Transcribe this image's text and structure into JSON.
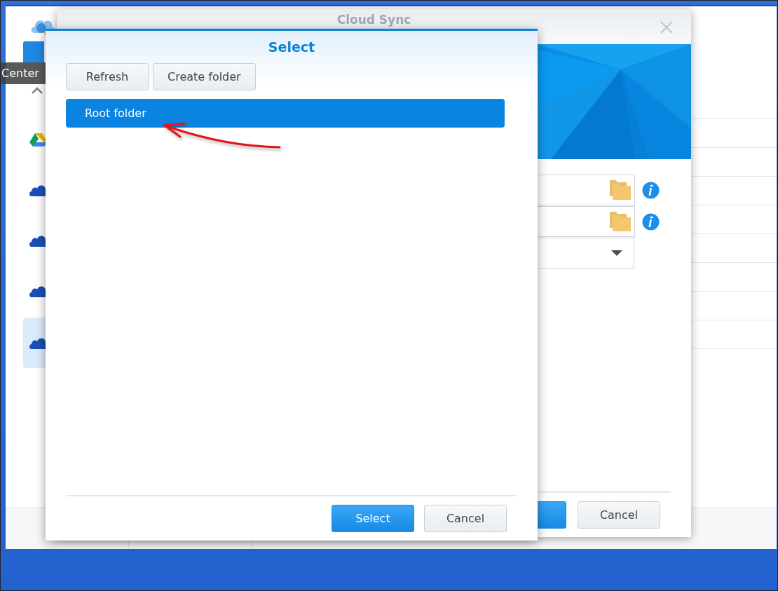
{
  "app": {
    "tooltip": "Center",
    "sidebar": {
      "items": [
        {
          "kind": "drive",
          "selected": false
        },
        {
          "kind": "cloud",
          "selected": false
        },
        {
          "kind": "cloud",
          "selected": false
        },
        {
          "kind": "cloud",
          "selected": false
        },
        {
          "kind": "cloud",
          "selected": true
        }
      ]
    }
  },
  "wizard": {
    "title": "Cloud Sync",
    "fields": [
      {
        "kind": "folder"
      },
      {
        "kind": "folder"
      },
      {
        "kind": "select"
      }
    ],
    "buttons": [
      {
        "primary": true
      },
      {
        "label": "Cancel",
        "primary": false
      }
    ]
  },
  "dialog": {
    "title": "Select",
    "toolbar": [
      "Refresh",
      "Create folder"
    ],
    "folders": [
      {
        "label": "Root folder",
        "selected": true
      }
    ],
    "buttons": [
      {
        "label": "Select",
        "primary": true
      },
      {
        "label": "Cancel",
        "primary": false
      }
    ]
  }
}
